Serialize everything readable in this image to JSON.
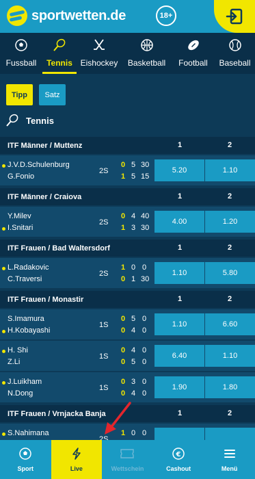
{
  "header": {
    "logo_text": "sportwetten.de",
    "age_badge": "18+",
    "colors": {
      "brand_blue": "#1a9bc4",
      "brand_yellow": "#f1e600",
      "dark_bg": "#0d3a57"
    }
  },
  "sports_nav": [
    {
      "label": "Fussball",
      "icon": "soccer-ball-icon"
    },
    {
      "label": "Tennis",
      "icon": "tennis-racket-icon",
      "active": true
    },
    {
      "label": "Eishockey",
      "icon": "hockey-sticks-icon"
    },
    {
      "label": "Basketball",
      "icon": "basketball-icon"
    },
    {
      "label": "Football",
      "icon": "american-football-icon"
    },
    {
      "label": "Baseball",
      "icon": "baseball-icon"
    }
  ],
  "filters": {
    "tipp": "Tipp",
    "satz": "Satz"
  },
  "section_title": "Tennis",
  "leagues": [
    {
      "name": "ITF Männer / Muttenz",
      "col1": "1",
      "col2": "2",
      "matches": [
        {
          "p1": "J.V.D.Schulenburg",
          "p2": "G.Fonio",
          "serve": 1,
          "set": "2S",
          "s1": [
            "0",
            "5",
            "30"
          ],
          "s2": [
            "1",
            "5",
            "15"
          ],
          "odd1": "5.20",
          "odd2": "1.10"
        }
      ]
    },
    {
      "name": "ITF Männer / Craiova",
      "col1": "1",
      "col2": "2",
      "matches": [
        {
          "p1": "Y.Milev",
          "p2": "I.Snitari",
          "serve": 2,
          "set": "2S",
          "s1": [
            "0",
            "4",
            "40"
          ],
          "s2": [
            "1",
            "3",
            "30"
          ],
          "odd1": "4.00",
          "odd2": "1.20"
        }
      ]
    },
    {
      "name": "ITF Frauen / Bad Waltersdorf",
      "col1": "1",
      "col2": "2",
      "matches": [
        {
          "p1": "L.Radakovic",
          "p2": "C.Traversi",
          "serve": 1,
          "set": "2S",
          "s1": [
            "1",
            "0",
            "0"
          ],
          "s2": [
            "0",
            "1",
            "30"
          ],
          "odd1": "1.10",
          "odd2": "5.80"
        }
      ]
    },
    {
      "name": "ITF Frauen / Monastir",
      "col1": "1",
      "col2": "2",
      "matches": [
        {
          "p1": "S.Imamura",
          "p2": "H.Kobayashi",
          "serve": 2,
          "set": "1S",
          "s1": [
            "0",
            "5",
            "0"
          ],
          "s2": [
            "0",
            "4",
            "0"
          ],
          "odd1": "1.10",
          "odd2": "6.60"
        },
        {
          "p1": "H. Shi",
          "p2": "Z.Li",
          "serve": 1,
          "set": "1S",
          "s1": [
            "0",
            "4",
            "0"
          ],
          "s2": [
            "0",
            "5",
            "0"
          ],
          "odd1": "6.40",
          "odd2": "1.10"
        },
        {
          "p1": "J.Luikham",
          "p2": "N.Dong",
          "serve": 1,
          "set": "1S",
          "s1": [
            "0",
            "3",
            "0"
          ],
          "s2": [
            "0",
            "4",
            "0"
          ],
          "odd1": "1.90",
          "odd2": "1.80"
        }
      ]
    },
    {
      "name": "ITF Frauen / Vrnjacka Banja",
      "col1": "1",
      "col2": "2",
      "matches": [
        {
          "p1": "S.Nahimana",
          "p2": "",
          "serve": 1,
          "set": "2S",
          "s1": [
            "1",
            "0",
            "0"
          ],
          "s2": [
            "",
            "",
            ""
          ],
          "odd1": "",
          "odd2": ""
        }
      ]
    }
  ],
  "bottom_nav": [
    {
      "label": "Sport",
      "icon": "soccer-ball-icon"
    },
    {
      "label": "Live",
      "icon": "lightning-icon",
      "active": true
    },
    {
      "label": "Wettschein",
      "icon": "ticket-icon",
      "disabled": true
    },
    {
      "label": "Cashout",
      "icon": "euro-coin-icon"
    },
    {
      "label": "Menü",
      "icon": "hamburger-menu-icon"
    }
  ]
}
